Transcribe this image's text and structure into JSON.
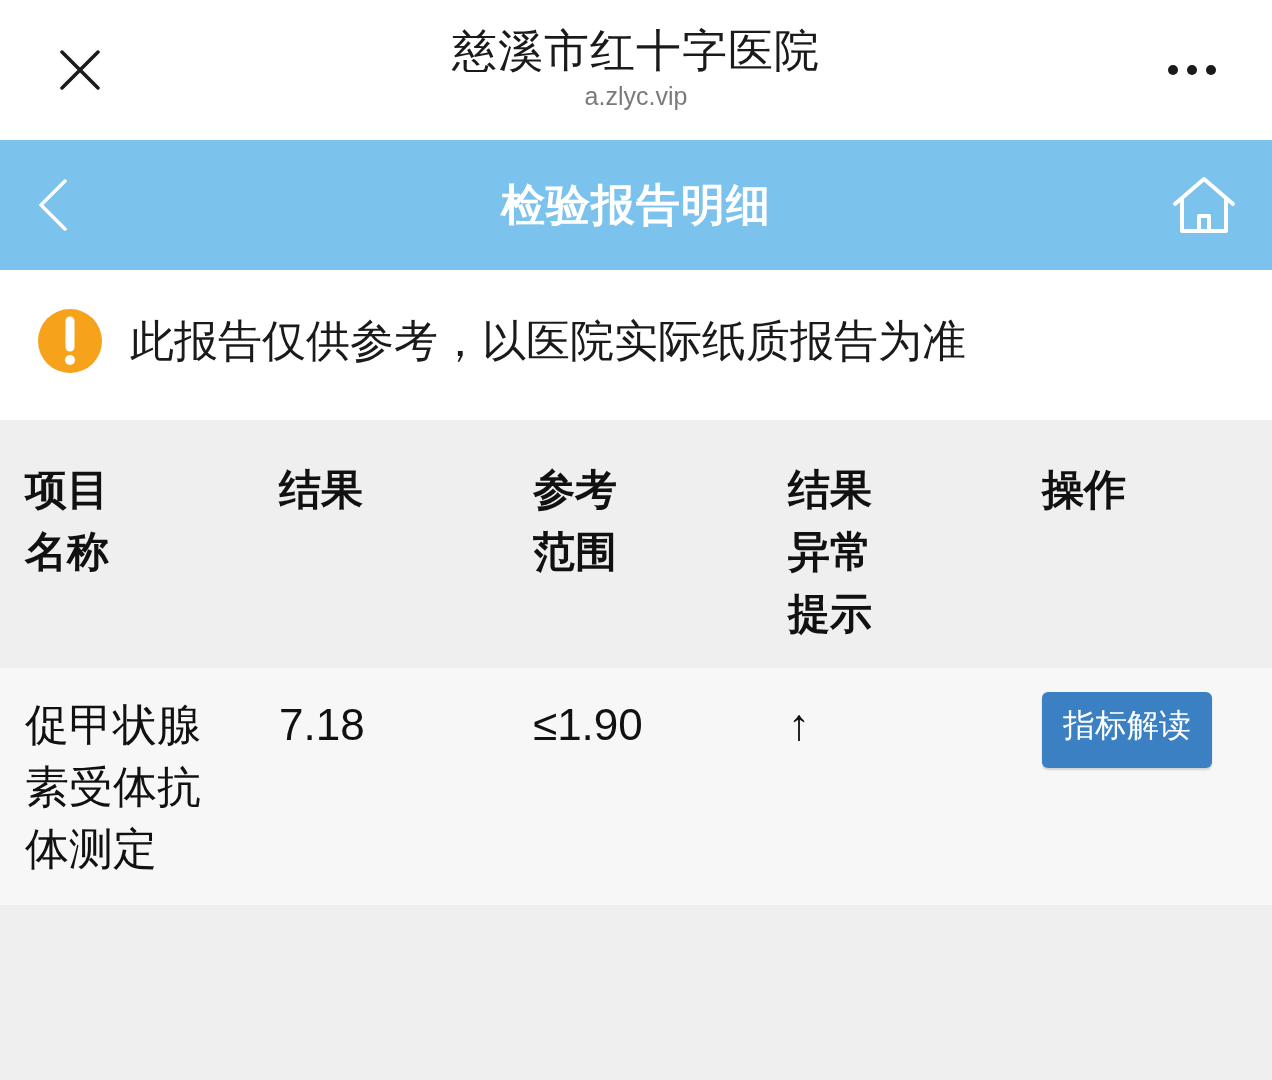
{
  "browser_bar": {
    "title": "慈溪市红十字医院",
    "url": "a.zlyc.vip"
  },
  "nav_bar": {
    "title": "检验报告明细"
  },
  "notice": {
    "text": "此报告仅供参考，以医院实际纸质报告为准"
  },
  "table": {
    "columns": [
      "项目名称",
      "结果",
      "参考范围",
      "结果异常提示",
      "操作"
    ],
    "rows": [
      {
        "item": "促甲状腺素受体抗体测定",
        "result": "7.18",
        "range": "≤1.90",
        "flag": "↑",
        "action": "指标解读"
      }
    ]
  }
}
